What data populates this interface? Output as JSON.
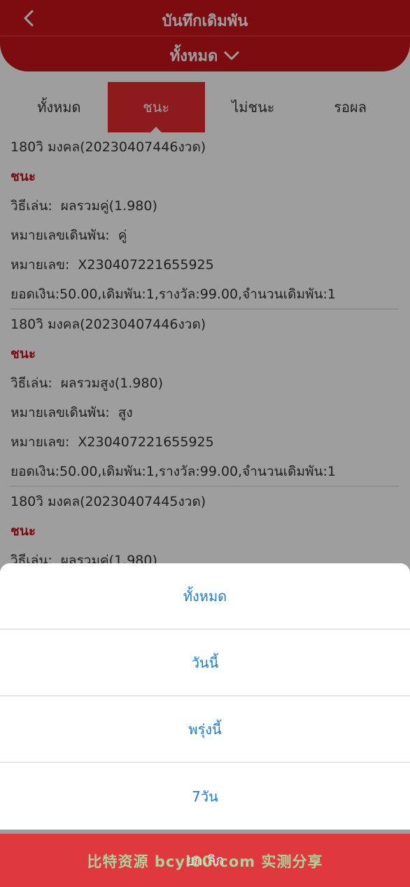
{
  "header": {
    "title": "บันทึกเดิมพัน",
    "filter_label": "ทั้งหมด"
  },
  "tabs": [
    {
      "label": "ทั้งหมด"
    },
    {
      "label": "ชนะ"
    },
    {
      "label": "ไม่ชนะ"
    },
    {
      "label": "รอผล"
    }
  ],
  "records": [
    {
      "title": "180วิ มงคล(20230407446งวด)",
      "status": "ชนะ",
      "method_label": "วิธีเล่น:",
      "method_value": "ผลรวมคู่(1.980)",
      "bet_label": "หมายเลขเดินพัน:",
      "bet_value": "คู่",
      "number_label": "หมายเลข:",
      "number_value": "X230407221655925",
      "summary": "ยอดเงิน:50.00,เดิมพัน:1,รางวัล:99.00,จำนวนเดิมพัน:1"
    },
    {
      "title": "180วิ มงคล(20230407446งวด)",
      "status": "ชนะ",
      "method_label": "วิธีเล่น:",
      "method_value": "ผลรวมสูง(1.980)",
      "bet_label": "หมายเลขเดินพัน:",
      "bet_value": "สูง",
      "number_label": "หมายเลข:",
      "number_value": "X230407221655925",
      "summary": "ยอดเงิน:50.00,เดิมพัน:1,รางวัล:99.00,จำนวนเดิมพัน:1"
    },
    {
      "title": "180วิ มงคล(20230407445งวด)",
      "status": "ชนะ",
      "method_label": "วิธีเล่น:",
      "method_value": "ผลรวมคู่(1.980)"
    }
  ],
  "sheet": {
    "options": [
      {
        "label": "ทั้งหมด"
      },
      {
        "label": "วันนี้"
      },
      {
        "label": "พรุ่งนี้"
      },
      {
        "label": "7วัน"
      }
    ],
    "cancel_label": "ยกเลิก"
  },
  "watermark": "比特资源 bcyi00.com 实测分享",
  "colors": {
    "brand_red": "#c8141b",
    "tab_active": "#e42a2f",
    "option_blue": "#1a7fc9",
    "cancel_red": "#df383e"
  }
}
